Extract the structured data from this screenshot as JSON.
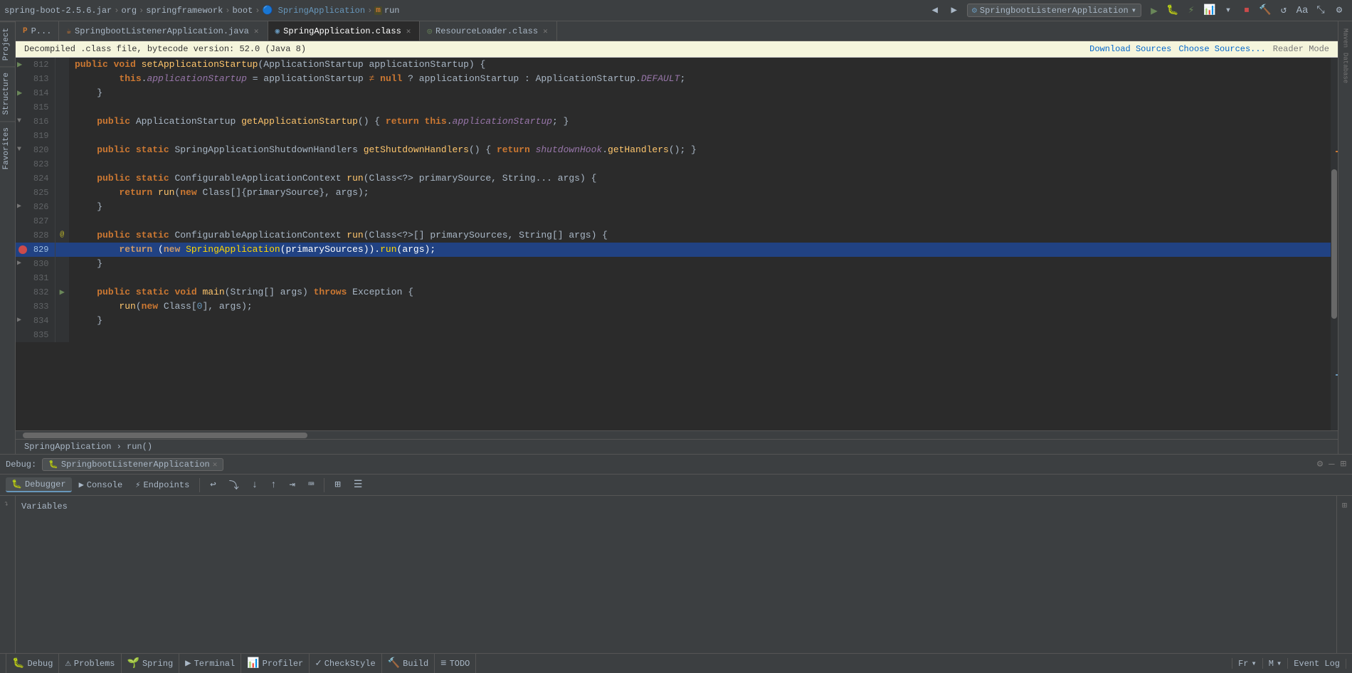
{
  "topbar": {
    "breadcrumb": [
      {
        "label": "spring-boot-2.5.6.jar",
        "type": "jar"
      },
      {
        "label": "org",
        "type": "pkg"
      },
      {
        "label": "springframework",
        "type": "pkg"
      },
      {
        "label": "boot",
        "type": "pkg"
      },
      {
        "label": "SpringApplication",
        "type": "class"
      },
      {
        "label": "run",
        "type": "method"
      }
    ],
    "run_config": "SpringbootListenerApplication",
    "icons": [
      "back",
      "forward",
      "run",
      "debug",
      "coverage",
      "profile",
      "stop",
      "build",
      "update",
      "translate",
      "expand",
      "settings"
    ]
  },
  "tabs": [
    {
      "label": "P...",
      "icon": "project",
      "active": false
    },
    {
      "label": "SpringbootListenerApplication.java",
      "icon": "java",
      "active": false,
      "closable": true
    },
    {
      "label": "SpringApplication.class",
      "icon": "class",
      "active": true,
      "closable": true
    },
    {
      "label": "ResourceLoader.class",
      "icon": "interface",
      "active": false,
      "closable": true
    }
  ],
  "decompiled_notice": {
    "text": "Decompiled .class file, bytecode version: 52.0 (Java 8)",
    "download_sources": "Download Sources",
    "choose_sources": "Choose Sources...",
    "reader_mode": "Reader Mode"
  },
  "code": {
    "lines": [
      {
        "num": "812",
        "gutter": "▶",
        "indent": 0,
        "content": "public void setApplicationStartup(ApplicationStartup applicationStartup) {",
        "types": [
          {
            "t": "kw",
            "v": "public"
          },
          {
            "t": "n",
            "v": " "
          },
          {
            "t": "kw",
            "v": "void"
          },
          {
            "t": "n",
            "v": " "
          },
          {
            "t": "method-name",
            "v": "setApplicationStartup"
          },
          {
            "t": "n",
            "v": "(ApplicationStartup applicationStartup) {"
          }
        ]
      },
      {
        "num": "813",
        "indent": 0,
        "content": "    this.applicationStartup = applicationStartup ≠ null ? applicationStartup : ApplicationStartup.DEFAULT;",
        "special": "assignment"
      },
      {
        "num": "814",
        "indent": 0,
        "content": "}",
        "simple": true
      },
      {
        "num": "815",
        "indent": 0,
        "content": "",
        "blank": true
      },
      {
        "num": "816",
        "indent": 0,
        "content": "public ApplicationStartup getApplicationStartup() { return this.applicationStartup; }",
        "collapsed": true
      },
      {
        "num": "819",
        "indent": 0,
        "content": "",
        "blank": true
      },
      {
        "num": "820",
        "indent": 0,
        "content": "public static SpringApplicationShutdownHandlers getShutdownHandlers() { return shutdownHook.getHandlers(); }",
        "collapsed": true
      },
      {
        "num": "823",
        "indent": 0,
        "content": "",
        "blank": true
      },
      {
        "num": "824",
        "indent": 0,
        "content": "public static ConfigurableApplicationContext run(Class<?> primarySource, String... args) {",
        "special": "method-header"
      },
      {
        "num": "825",
        "indent": 1,
        "content": "    return run(new Class[]{primarySource}, args);"
      },
      {
        "num": "826",
        "indent": 0,
        "content": "}"
      },
      {
        "num": "827",
        "indent": 0,
        "content": "",
        "blank": true
      },
      {
        "num": "828",
        "indent": 0,
        "content": "public static ConfigurableApplicationContext run(Class<?>[] primarySources, String[] args) {",
        "annotation": "@",
        "special": "method-header2"
      },
      {
        "num": "829",
        "indent": 1,
        "content": "    return (new SpringApplication(primarySources)).run(args);",
        "highlighted": true,
        "breakpoint": true
      },
      {
        "num": "830",
        "indent": 0,
        "content": "}"
      },
      {
        "num": "831",
        "indent": 0,
        "content": "",
        "blank": true
      },
      {
        "num": "832",
        "indent": 0,
        "content": "public static void main(String[] args) throws Exception {",
        "run_arrow": true
      },
      {
        "num": "833",
        "indent": 1,
        "content": "    run(new Class[0], args);"
      },
      {
        "num": "834",
        "indent": 0,
        "content": "}"
      },
      {
        "num": "835",
        "indent": 0,
        "content": "",
        "blank": true
      }
    ]
  },
  "code_breadcrumb": "SpringApplication  ›  run()",
  "debug": {
    "label": "Debug:",
    "session": "SpringbootListenerApplication",
    "tabs": [
      {
        "label": "Debugger",
        "icon": "🐛",
        "active": true
      },
      {
        "label": "Console",
        "icon": "▶",
        "active": false
      },
      {
        "label": "Endpoints",
        "icon": "⚡",
        "active": false
      }
    ],
    "toolbar_icons": [
      "restore",
      "step-over",
      "step-into",
      "step-out",
      "run-to-cursor",
      "evaluate",
      "watch",
      "frames"
    ],
    "variables_label": "Variables"
  },
  "status_bar": {
    "items": [
      {
        "icon": "🐛",
        "label": "Debug",
        "active": true
      },
      {
        "icon": "⚠",
        "label": "Problems"
      },
      {
        "icon": "🌱",
        "label": "Spring"
      },
      {
        "icon": "▶",
        "label": "Terminal"
      },
      {
        "icon": "📊",
        "label": "Profiler"
      },
      {
        "icon": "✓",
        "label": "CheckStyle"
      },
      {
        "icon": "🔨",
        "label": "Build"
      },
      {
        "icon": "≡",
        "label": "TODO"
      }
    ],
    "right": "Event Log",
    "fr_label": "Fr",
    "m_label": "M"
  },
  "left_tabs": [
    {
      "label": "Project",
      "active": false
    },
    {
      "label": "Structure",
      "active": false
    },
    {
      "label": "Favorites",
      "active": false
    }
  ]
}
